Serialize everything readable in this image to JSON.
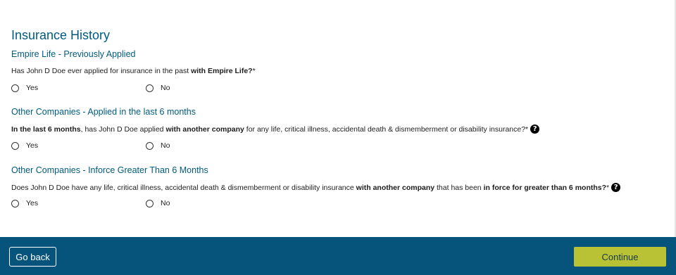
{
  "page": {
    "title": "Insurance History"
  },
  "sections": [
    {
      "title": "Empire Life - Previously Applied",
      "question_parts": [
        {
          "text": "Has John D Doe ever applied for insurance in the past ",
          "bold": false
        },
        {
          "text": "with Empire Life?",
          "bold": true
        },
        {
          "text": "*",
          "bold": false
        }
      ],
      "has_help": false,
      "options": [
        "Yes",
        "No"
      ]
    },
    {
      "title": "Other Companies - Applied in the last 6 months",
      "question_parts": [
        {
          "text": "In the last 6 months",
          "bold": true
        },
        {
          "text": ", has John D Doe applied ",
          "bold": false
        },
        {
          "text": "with another company",
          "bold": true
        },
        {
          "text": " for any life, critical illness, accidental death & dismemberment or disability insurance?*",
          "bold": false
        }
      ],
      "has_help": true,
      "options": [
        "Yes",
        "No"
      ]
    },
    {
      "title": "Other Companies - Inforce Greater Than 6 Months",
      "question_parts": [
        {
          "text": "Does John D Doe have any life, critical illness, accidental death & dismemberment or disability insurance ",
          "bold": false
        },
        {
          "text": "with another company",
          "bold": true
        },
        {
          "text": " that has been ",
          "bold": false
        },
        {
          "text": "in force for greater than 6 months?",
          "bold": true
        },
        {
          "text": "*",
          "bold": false
        }
      ],
      "has_help": true,
      "options": [
        "Yes",
        "No"
      ]
    }
  ],
  "footer": {
    "back_label": "Go back",
    "continue_label": "Continue",
    "colors": {
      "footer_bg": "#06547c",
      "continue_bg": "#b9c234",
      "heading": "#005b7f"
    }
  },
  "icons": {
    "help": "question-mark-circle-icon",
    "help_glyph": "?"
  }
}
